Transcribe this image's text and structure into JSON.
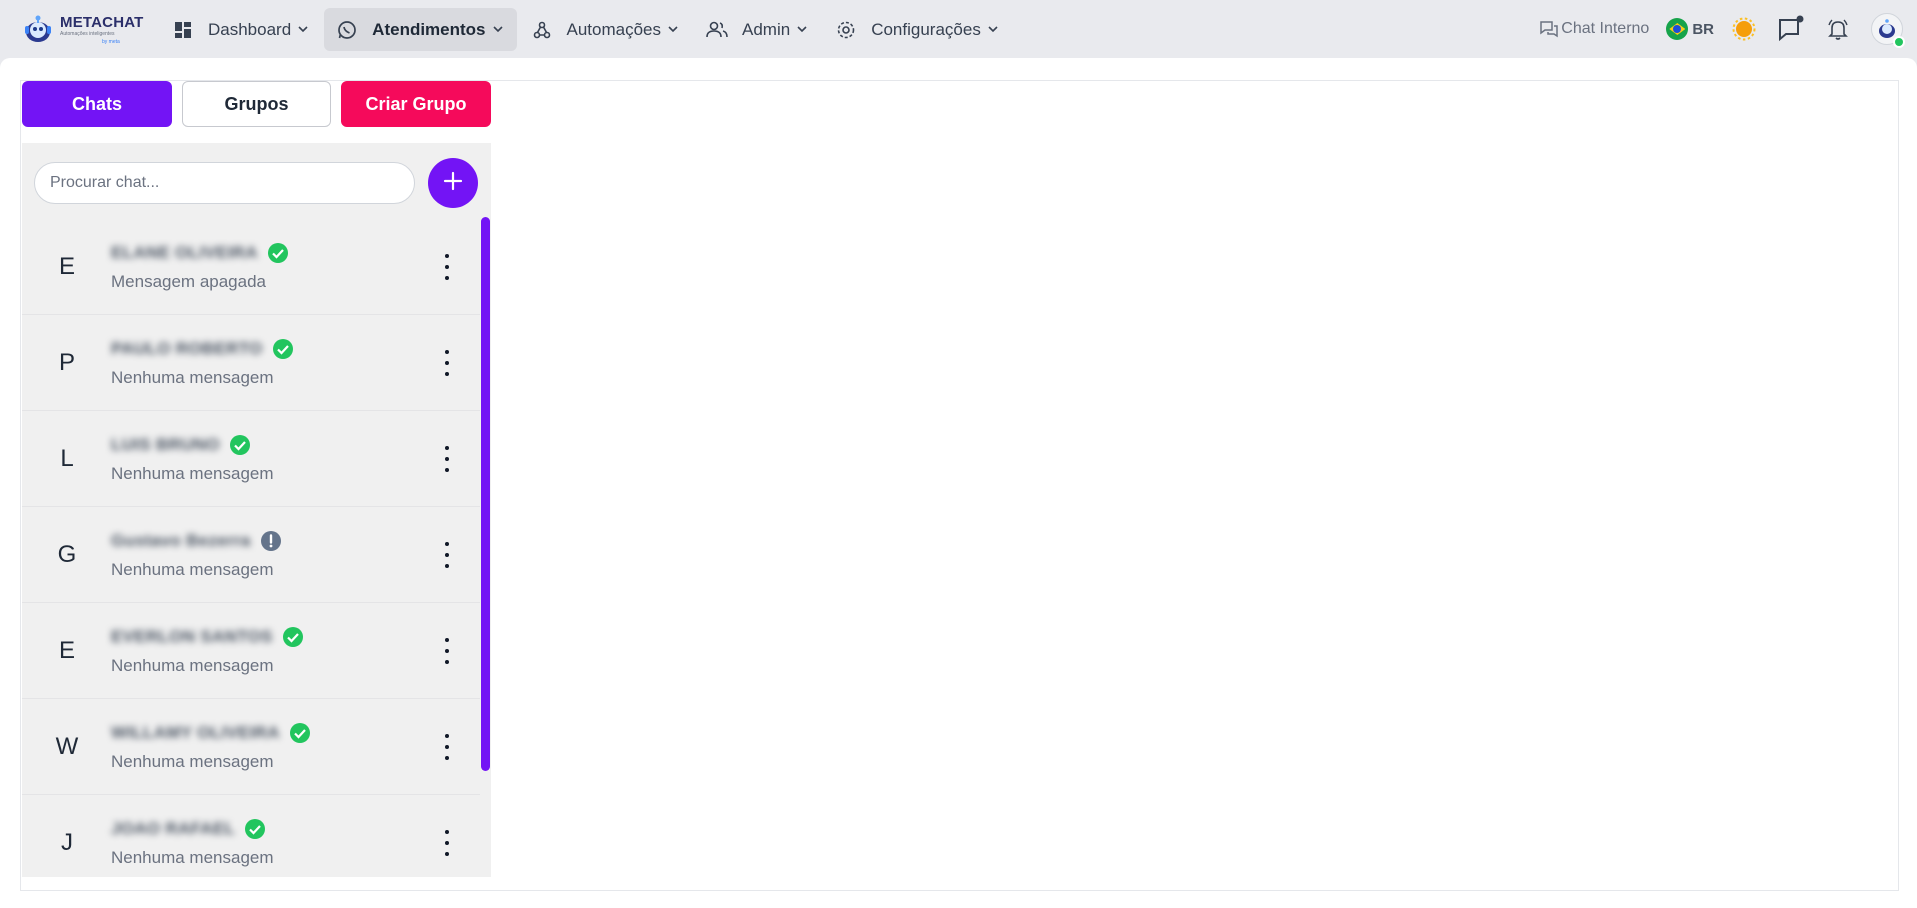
{
  "app": {
    "logo_title": "METACHAT",
    "logo_sub": "Automações inteligentes",
    "logo_sub2": "by meta"
  },
  "nav": [
    {
      "label": "Dashboard",
      "icon": "dashboard-icon",
      "active": false
    },
    {
      "label": "Atendimentos",
      "icon": "whatsapp-icon",
      "active": true
    },
    {
      "label": "Automações",
      "icon": "webhook-icon",
      "active": false
    },
    {
      "label": "Admin",
      "icon": "users-icon",
      "active": false
    },
    {
      "label": "Configurações",
      "icon": "gear-icon",
      "active": false
    }
  ],
  "toolbar": {
    "chat_interno": "Chat Interno",
    "lang": "BR"
  },
  "tabs": {
    "chats": "Chats",
    "grupos": "Grupos",
    "criar": "Criar Grupo"
  },
  "search": {
    "placeholder": "Procurar chat..."
  },
  "chats": [
    {
      "initial": "E",
      "name": "ELANE OLIVEIRA",
      "last_message": "Mensagem apagada",
      "status": "verified"
    },
    {
      "initial": "P",
      "name": "PAULO ROBERTO",
      "last_message": "Nenhuma mensagem",
      "status": "verified"
    },
    {
      "initial": "L",
      "name": "LUIS BRUNO",
      "last_message": "Nenhuma mensagem",
      "status": "verified"
    },
    {
      "initial": "G",
      "name": "Gustavo Bezerra",
      "last_message": "Nenhuma mensagem",
      "status": "warning"
    },
    {
      "initial": "E",
      "name": "EVERLON SANTOS",
      "last_message": "Nenhuma mensagem",
      "status": "verified"
    },
    {
      "initial": "W",
      "name": "WILLAMY OLIVEIRA",
      "last_message": "Nenhuma mensagem",
      "status": "verified"
    },
    {
      "initial": "J",
      "name": "JOAO RAFAEL",
      "last_message": "Nenhuma mensagem",
      "status": "verified"
    }
  ],
  "colors": {
    "primary": "#7314f5",
    "danger": "#f50a5b",
    "success": "#22c55e",
    "muted": "#64748b"
  }
}
